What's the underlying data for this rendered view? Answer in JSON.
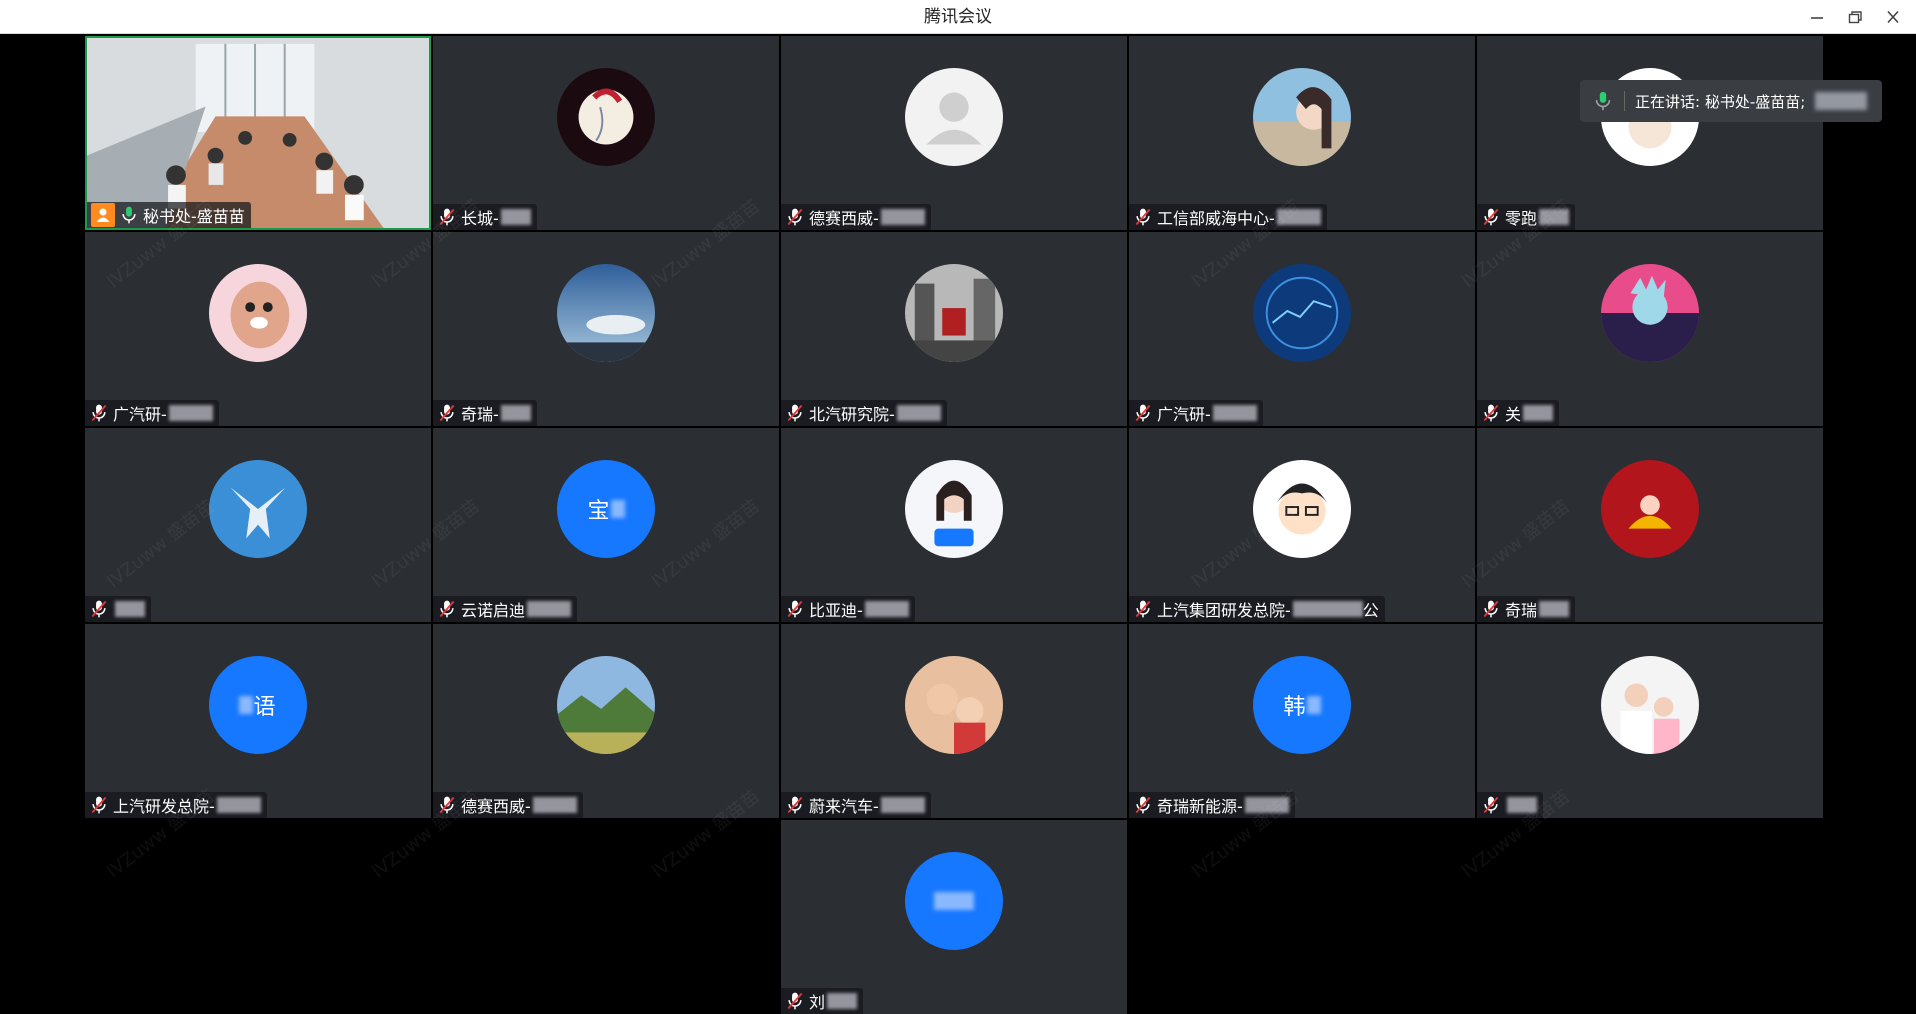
{
  "window": {
    "title": "腾讯会议",
    "controls": [
      "minimize-icon",
      "restore-icon",
      "close-icon"
    ]
  },
  "speaking_indicator": {
    "text": "正在讲话: 秘书处-盛苗苗;"
  },
  "watermark_text": "lVZuww 盛苗苗",
  "participants": [
    {
      "name": "秘书处-盛苗苗",
      "muted": false,
      "host": true,
      "video": true
    },
    {
      "name": "长城-",
      "muted": true
    },
    {
      "name": "德赛西威-",
      "muted": true
    },
    {
      "name": "工信部威海中心-",
      "muted": true
    },
    {
      "name": "零跑",
      "muted": true
    },
    {
      "name": "广汽研-",
      "muted": true
    },
    {
      "name": "奇瑞-",
      "muted": true
    },
    {
      "name": "北汽研究院-",
      "muted": true
    },
    {
      "name": "广汽研-",
      "muted": true
    },
    {
      "name": "关",
      "muted": true
    },
    {
      "name": "",
      "muted": true
    },
    {
      "name": "云诺启迪",
      "muted": true,
      "avatar_text": "宝"
    },
    {
      "name": "比亚迪-",
      "muted": true
    },
    {
      "name": "上汽集团研发总院-",
      "name_suffix": "公",
      "muted": true
    },
    {
      "name": "奇瑞",
      "muted": true
    },
    {
      "name": "上汽研发总院-",
      "muted": true,
      "avatar_text": "语"
    },
    {
      "name": "德赛西威-",
      "muted": true
    },
    {
      "name": "蔚来汽车-",
      "muted": true
    },
    {
      "name": "奇瑞新能源-",
      "muted": true,
      "avatar_text": "韩"
    },
    {
      "name": "",
      "muted": true
    },
    {
      "name": "刘",
      "muted": true,
      "avatar_text": ""
    }
  ],
  "colors": {
    "tile_bg": "#2b2e33",
    "active_border": "#1a9a4a",
    "avatar_blue": "#1677ff",
    "host_badge": "#ff8a1f",
    "mic_muted": "#e03a3a",
    "mic_active": "#2ecc71"
  }
}
